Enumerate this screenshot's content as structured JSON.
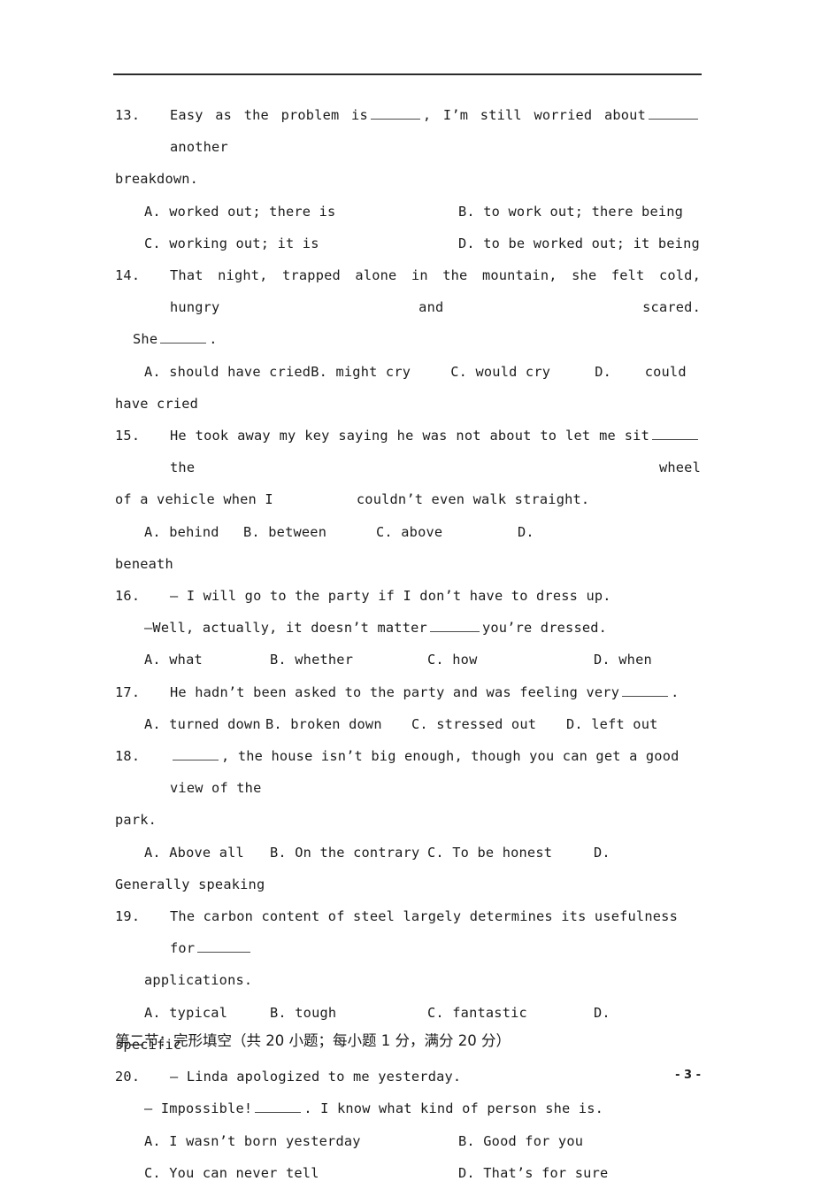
{
  "page": {
    "number_label": "- 3 -",
    "header_rule": true
  },
  "questions": [
    {
      "number": "13.",
      "stem_line1": "Easy as the problem is",
      "stem_line1b": ", I’m still worried about",
      "stem_line1c": "another",
      "stem_line2": "breakdown.",
      "options": [
        {
          "label": "A.",
          "text": "worked out; there is"
        },
        {
          "label": "B.",
          "text": "to work out; there being"
        },
        {
          "label": "C.",
          "text": "working out; it is"
        },
        {
          "label": "D.",
          "text": "to be worked out; it being"
        }
      ]
    },
    {
      "number": "14.",
      "stem_line1": "That night, trapped alone in the mountain, she felt cold, hungry and scared.",
      "stem_line2_pre": "She",
      "stem_line2_post": ".",
      "options": [
        {
          "label": "A.",
          "text": "should have cried"
        },
        {
          "label": "B.",
          "text": "might cry"
        },
        {
          "label": "C.",
          "text": "would cry"
        },
        {
          "label": "D.",
          "text": "could"
        }
      ],
      "options_wrap": "have cried"
    },
    {
      "number": "15.",
      "stem_line1": "He took away my key saying he was not about to let me sit",
      "stem_line1b": "the wheel",
      "stem_line2": "of a vehicle when I          couldn’t even walk straight.",
      "options": [
        {
          "label": "A.",
          "text": "behind"
        },
        {
          "label": "B.",
          "text": "between"
        },
        {
          "label": "C.",
          "text": "above"
        },
        {
          "label": "D.",
          "text": ""
        }
      ],
      "options_wrap": "beneath"
    },
    {
      "number": "16.",
      "stem_line1": "— I will go to the party if I don’t have to dress up.",
      "stem_line2_pre": "—Well, actually, it doesn’t matter",
      "stem_line2_post": "you’re dressed.",
      "options": [
        {
          "label": "A.",
          "text": "what"
        },
        {
          "label": "B.",
          "text": "whether"
        },
        {
          "label": "C.",
          "text": "how"
        },
        {
          "label": "D.",
          "text": "when"
        }
      ]
    },
    {
      "number": "17.",
      "stem_line1": "He hadn’t been asked to the party and was feeling very",
      "stem_line1b": ".",
      "options": [
        {
          "label": "A.",
          "text": "turned down"
        },
        {
          "label": "B.",
          "text": "broken down"
        },
        {
          "label": "C.",
          "text": "stressed out"
        },
        {
          "label": "D.",
          "text": "left out"
        }
      ]
    },
    {
      "number": "18.",
      "stem_line1_pre": "",
      "stem_line1_post": ", the house isn’t big enough, though you can get a good view of the",
      "stem_line2": "park.",
      "options": [
        {
          "label": "A.",
          "text": "Above all"
        },
        {
          "label": "B.",
          "text": "On the contrary"
        },
        {
          "label": "C.",
          "text": "To be honest"
        },
        {
          "label": "D.",
          "text": ""
        }
      ],
      "options_wrap": "Generally speaking"
    },
    {
      "number": "19.",
      "stem_line1": "The carbon content of steel largely determines its usefulness for",
      "stem_line2": "applications.",
      "options": [
        {
          "label": "A.",
          "text": "typical"
        },
        {
          "label": "B.",
          "text": "tough"
        },
        {
          "label": "C.",
          "text": "fantastic"
        },
        {
          "label": "D.",
          "text": ""
        }
      ],
      "options_wrap": "specific"
    },
    {
      "number": "20.",
      "stem_line1": "— Linda apologized to me yesterday.",
      "stem_line2_pre": "— Impossible!",
      "stem_line2_post": ". I know what kind of person she is.",
      "options": [
        {
          "label": "A.",
          "text": "I wasn’t born yesterday"
        },
        {
          "label": "B.",
          "text": "Good for you"
        },
        {
          "label": "C.",
          "text": "You can never tell"
        },
        {
          "label": "D.",
          "text": "That’s for sure"
        }
      ]
    }
  ],
  "section": {
    "heading": "第二节：完形填空（共 20 小题；每小题 1 分，满分 20 分）"
  }
}
